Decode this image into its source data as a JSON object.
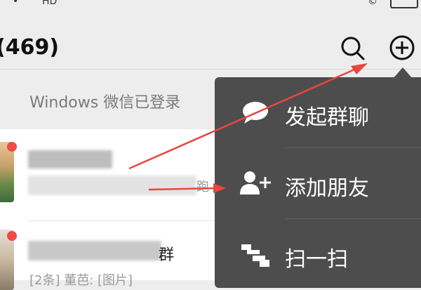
{
  "status": {
    "signal_glyph": "•",
    "carrier": "HD",
    "right_glyph": "©"
  },
  "header": {
    "title": "(469)",
    "search_icon": "search-icon",
    "add_icon": "plus-circle-icon"
  },
  "banner": {
    "text": "Windows 微信已登录"
  },
  "chats": [
    {
      "name_fragment": "",
      "preview_fragment": "跑",
      "unread": true
    },
    {
      "name_fragment": "群",
      "preview_fragment": "[2条] 董芭: [图片]",
      "unread": true
    }
  ],
  "menu": {
    "items": [
      {
        "label": "发起群聊",
        "icon": "chat-bubble-icon"
      },
      {
        "label": "添加朋友",
        "icon": "add-user-icon"
      },
      {
        "label": "扫一扫",
        "icon": "scan-icon"
      }
    ]
  },
  "colors": {
    "accent_red": "#f04b46",
    "menu_bg": "#4d4d4d",
    "arrow_red": "#e8463e"
  }
}
